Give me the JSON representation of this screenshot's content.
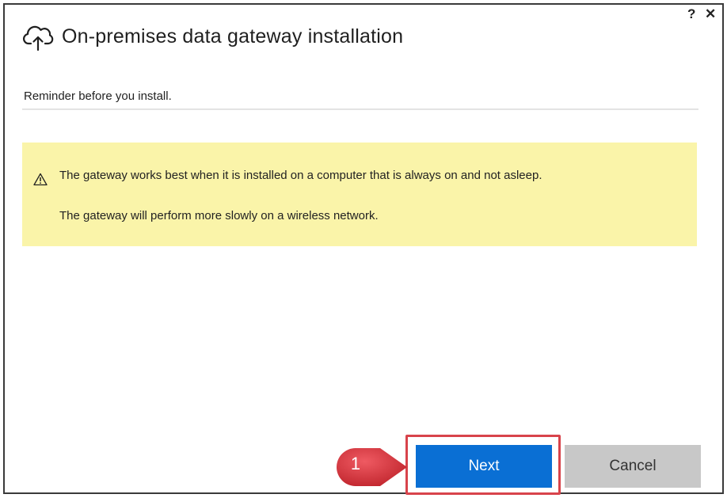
{
  "dialog": {
    "title": "On-premises data gateway installation",
    "help_label": "?",
    "close_label": "✕",
    "subtitle": "Reminder before you install.",
    "warnings": [
      "The gateway works best when it is installed on a computer that is always on and not asleep.",
      "The gateway will perform more slowly on a wireless network."
    ],
    "buttons": {
      "next": "Next",
      "cancel": "Cancel"
    }
  },
  "annotation": {
    "step_number": "1"
  },
  "icons": {
    "header": "cloud-upload-icon",
    "warning": "warning-triangle-icon"
  },
  "colors": {
    "warning_bg": "#faf4a9",
    "next_bg": "#0a6fd4",
    "cancel_bg": "#c8c8c8",
    "highlight": "#d8434b",
    "marker": "#d8434b"
  }
}
